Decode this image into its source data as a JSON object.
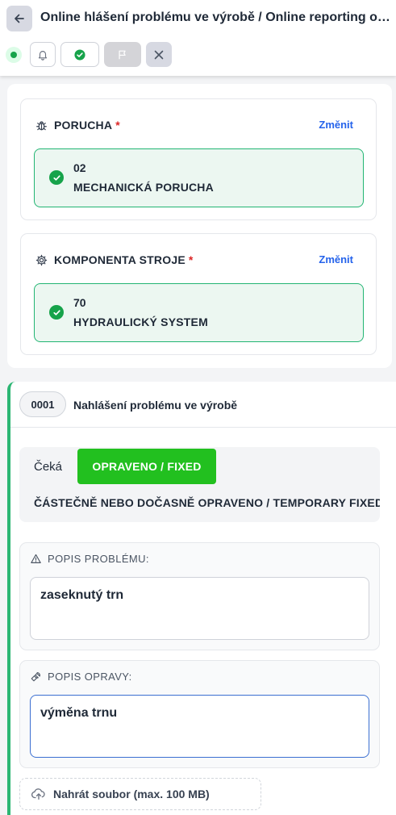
{
  "header": {
    "title": "Online hlášení problému ve výrobě / Online reporting of problems in production",
    "icons": {
      "back": "arrow-left-icon",
      "status": "online-dot-icon",
      "bell": "bell-icon",
      "check": "check-circle-icon",
      "flag": "flag-icon",
      "close": "close-icon"
    }
  },
  "selection": {
    "fault": {
      "label": "PORUCHA",
      "required_mark": "*",
      "change_label": "Změnit",
      "code": "02",
      "name": "MECHANICKÁ PORUCHA",
      "icon": "bug-icon"
    },
    "component": {
      "label": "KOMPONENTA STROJE",
      "required_mark": "*",
      "change_label": "Změnit",
      "code": "70",
      "name": "HYDRAULICKÝ SYSTEM",
      "icon": "gear-icon"
    }
  },
  "report": {
    "number": "0001",
    "title": "Nahlášení problému ve výrobě",
    "status_options": {
      "waiting": "Čeká",
      "fixed": "OPRAVENO / FIXED",
      "temporary": "ČÁSTEČNĚ NEBO DOČASNĚ OPRAVENO / TEMPORARY FIXED"
    },
    "problem_label": "POPIS PROBLÉMU:",
    "problem_value": "zaseknutý trn",
    "repair_label": "POPIS OPRAVY:",
    "repair_value": "výměna trnu",
    "upload_label": "Nahrát soubor (max. 100 MB)"
  },
  "colors": {
    "accent_green": "#22c01f",
    "success": "#16a34a",
    "link": "#2563eb",
    "required": "#dc2626"
  }
}
